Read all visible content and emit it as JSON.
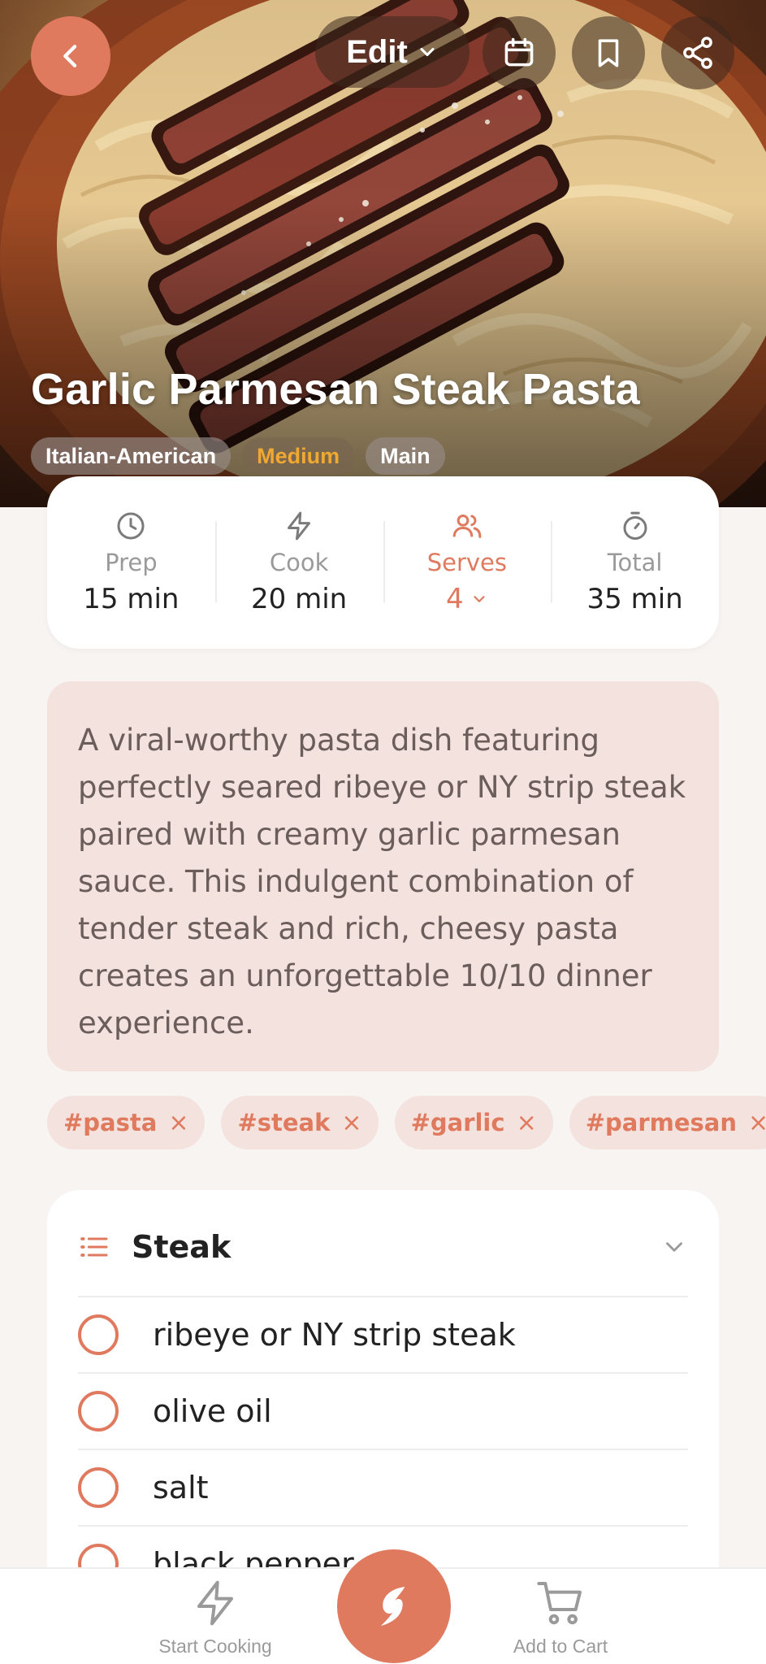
{
  "header": {
    "edit_label": "Edit"
  },
  "recipe": {
    "title": "Garlic Parmesan Steak Pasta",
    "chips": [
      "Italian-American",
      "Medium",
      "Main"
    ],
    "description": "A viral-worthy pasta dish featuring perfectly seared ribeye or NY strip steak paired with creamy garlic parmesan sauce. This indulgent combination of tender steak and rich, cheesy pasta creates an unforgettable 10/10 dinner experience."
  },
  "stats": {
    "prep": {
      "label": "Prep",
      "value": "15 min"
    },
    "cook": {
      "label": "Cook",
      "value": "20 min"
    },
    "serves": {
      "label": "Serves",
      "value": "4"
    },
    "total": {
      "label": "Total",
      "value": "35 min"
    }
  },
  "tags": [
    "#pasta",
    "#steak",
    "#garlic",
    "#parmesan"
  ],
  "tag_remove_glyph": "×",
  "ingredients": {
    "section_title": "Steak",
    "items": [
      "ribeye or NY strip steak",
      "olive oil",
      "salt",
      "black pepper"
    ]
  },
  "bottom_nav": {
    "start_cooking": "Start Cooking",
    "add_to_cart": "Add to Cart"
  },
  "colors": {
    "accent": "#e07a5f",
    "difficulty": "#f0a830",
    "card_tint": "#f3e2dd"
  },
  "icons": [
    "chevron-left-icon",
    "chevron-down-icon",
    "calendar-icon",
    "bookmark-icon",
    "share-icon",
    "clock-icon",
    "lightning-icon",
    "users-icon",
    "timer-icon",
    "list-icon",
    "leaf-icon",
    "cart-icon"
  ]
}
